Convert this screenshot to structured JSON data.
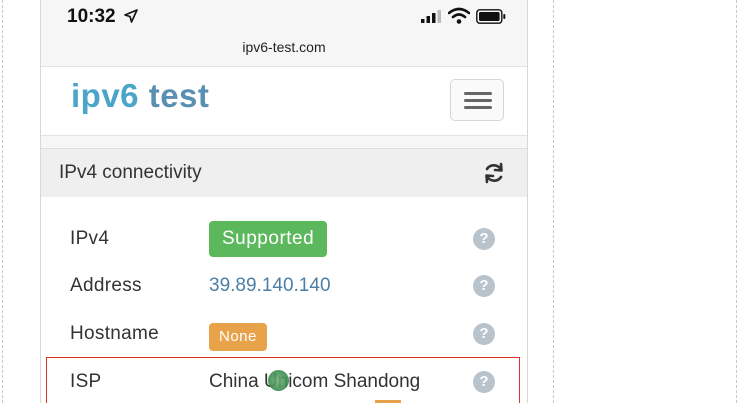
{
  "status_bar": {
    "time": "10:32",
    "icons": [
      "location-arrow-icon",
      "signal-icon",
      "wifi-icon",
      "battery-icon"
    ]
  },
  "browser": {
    "url": "ipv6-test.com"
  },
  "site": {
    "logo_part1": "ipv6",
    "logo_part2": " test",
    "menu_icon": "hamburger-menu-icon"
  },
  "panel": {
    "title": "IPv4 connectivity",
    "refresh_icon": "refresh-icon",
    "rows": [
      {
        "label": "IPv4",
        "value": "Supported",
        "type": "badge-success"
      },
      {
        "label": "Address",
        "value": "39.89.140.140",
        "type": "link"
      },
      {
        "label": "Hostname",
        "value": "None",
        "type": "badge-warning"
      },
      {
        "label": "ISP",
        "value": "China Unicom Shandong",
        "type": "text"
      }
    ],
    "help_symbol": "?"
  },
  "colors": {
    "success": "#5cb85c",
    "warning": "#e8a24a",
    "highlight": "#d9342b",
    "logo": "#4aa5c8",
    "link": "#4d7fa6"
  }
}
